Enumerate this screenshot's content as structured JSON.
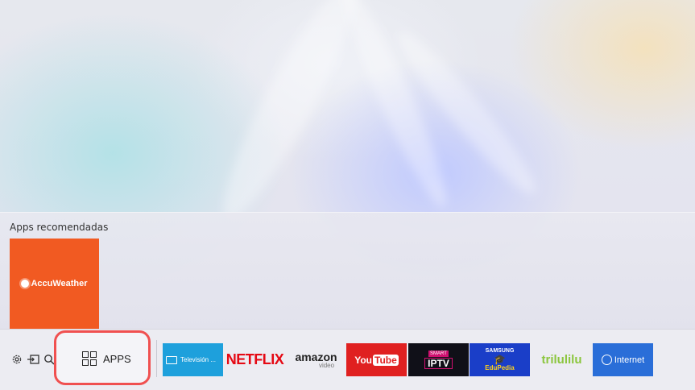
{
  "recommended": {
    "title": "Apps recomendadas",
    "items": [
      {
        "name": "AccuWeather",
        "color": "#f15a22"
      }
    ]
  },
  "bottom_bar": {
    "system_icons": [
      "settings-icon",
      "source-input-icon",
      "search-icon"
    ],
    "apps_label": "APPS",
    "apps_focus_color": "#f05050"
  },
  "app_row": {
    "tv": {
      "label": "Televisión ...",
      "color": "#1ea0dc"
    },
    "netflix": {
      "label": "NETFLIX",
      "color": "#e50914"
    },
    "amazon": {
      "word": "amazon",
      "sub": "video"
    },
    "youtube": {
      "you": "You",
      "tube": "Tube",
      "color": "#e02020"
    },
    "iptv": {
      "top": "SMART",
      "main": "IPTV"
    },
    "edupedia": {
      "brand": "SAMSUNG",
      "name": "EduPedia",
      "color": "#1a3ec8"
    },
    "trilulilu": {
      "label": "trilulilu",
      "color": "#8cc63f"
    },
    "internet": {
      "label": "Internet",
      "color": "#2a6ed8"
    }
  }
}
